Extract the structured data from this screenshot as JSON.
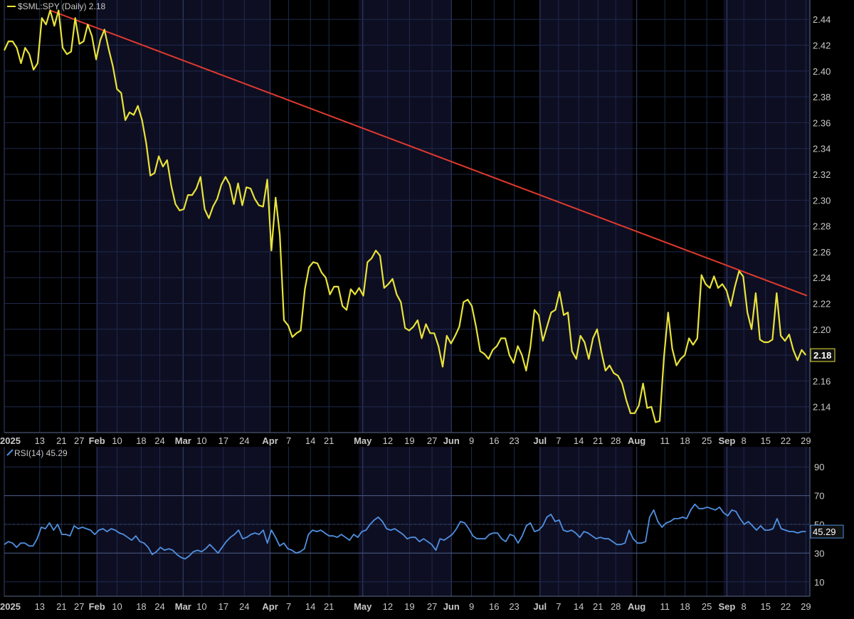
{
  "chart_data": [
    {
      "type": "line",
      "title": "$SML:SPY (Daily) 2.18",
      "last_value_label": "2.18",
      "ylim": [
        2.12,
        2.455
      ],
      "yticks": [
        "2.44",
        "2.42",
        "2.40",
        "2.38",
        "2.36",
        "2.34",
        "2.32",
        "2.30",
        "2.28",
        "2.26",
        "2.24",
        "2.22",
        "2.20",
        "2.18",
        "2.16",
        "2.14"
      ],
      "grid": true,
      "x_tick_labels": [
        "2025",
        "13",
        "21",
        "27",
        "Feb",
        "10",
        "18",
        "24",
        "Mar",
        "10",
        "17",
        "24",
        "Apr",
        "7",
        "14",
        "21",
        "May",
        "12",
        "19",
        "27",
        "Jun",
        "9",
        "16",
        "23",
        "Jul",
        "7",
        "14",
        "21",
        "28",
        "Aug",
        "11",
        "18",
        "25",
        "Sep",
        "8",
        "15",
        "22",
        "29"
      ],
      "series": [
        {
          "name": "$SML:SPY",
          "color": "#e8e33a",
          "values": [
            2.416,
            2.423,
            2.423,
            2.418,
            2.406,
            2.418,
            2.413,
            2.401,
            2.406,
            2.441,
            2.436,
            2.447,
            2.435,
            2.447,
            2.418,
            2.413,
            2.415,
            2.441,
            2.421,
            2.423,
            2.436,
            2.427,
            2.409,
            2.424,
            2.432,
            2.417,
            2.404,
            2.386,
            2.383,
            2.362,
            2.368,
            2.366,
            2.373,
            2.362,
            2.344,
            2.319,
            2.321,
            2.334,
            2.326,
            2.331,
            2.311,
            2.297,
            2.292,
            2.293,
            2.304,
            2.304,
            2.309,
            2.318,
            2.293,
            2.286,
            2.295,
            2.301,
            2.312,
            2.318,
            2.312,
            2.297,
            2.313,
            2.296,
            2.31,
            2.309,
            2.301,
            2.296,
            2.295,
            2.316,
            2.261,
            2.302,
            2.273,
            2.207,
            2.203,
            2.194,
            2.197,
            2.199,
            2.231,
            2.248,
            2.252,
            2.251,
            2.244,
            2.24,
            2.227,
            2.233,
            2.233,
            2.218,
            2.215,
            2.231,
            2.227,
            2.232,
            2.226,
            2.252,
            2.255,
            2.261,
            2.257,
            2.232,
            2.235,
            2.239,
            2.227,
            2.221,
            2.201,
            2.199,
            2.202,
            2.207,
            2.193,
            2.204,
            2.197,
            2.197,
            2.187,
            2.171,
            2.195,
            2.189,
            2.195,
            2.202,
            2.221,
            2.223,
            2.218,
            2.202,
            2.183,
            2.181,
            2.177,
            2.184,
            2.187,
            2.193,
            2.193,
            2.18,
            2.174,
            2.187,
            2.18,
            2.168,
            2.186,
            2.215,
            2.211,
            2.191,
            2.202,
            2.213,
            2.215,
            2.229,
            2.211,
            2.213,
            2.183,
            2.177,
            2.195,
            2.19,
            2.177,
            2.193,
            2.2,
            2.183,
            2.168,
            2.172,
            2.166,
            2.164,
            2.158,
            2.145,
            2.135,
            2.135,
            2.141,
            2.158,
            2.139,
            2.14,
            2.128,
            2.129,
            2.178,
            2.213,
            2.185,
            2.172,
            2.177,
            2.18,
            2.193,
            2.188,
            2.193,
            2.242,
            2.235,
            2.232,
            2.241,
            2.232,
            2.235,
            2.23,
            2.218,
            2.233,
            2.245,
            2.241,
            2.213,
            2.2,
            2.228,
            2.192,
            2.19,
            2.19,
            2.192,
            2.228,
            2.195,
            2.191,
            2.196,
            2.184,
            2.176,
            2.184,
            2.18
          ]
        }
      ],
      "trendline": {
        "color": "#e03a2e",
        "start_value": 2.447,
        "end_value": 2.226
      }
    },
    {
      "type": "line",
      "title": "RSI(14) 45.29",
      "last_value_label": "45.29",
      "ylim": [
        0,
        100
      ],
      "yticks": [
        "90",
        "70",
        "50",
        "30",
        "10"
      ],
      "overbought": 70,
      "oversold": 30,
      "grid": true,
      "x_tick_labels": [
        "2025",
        "13",
        "21",
        "27",
        "Feb",
        "10",
        "18",
        "24",
        "Mar",
        "10",
        "17",
        "24",
        "Apr",
        "7",
        "14",
        "21",
        "May",
        "12",
        "19",
        "27",
        "Jun",
        "9",
        "16",
        "23",
        "Jul",
        "7",
        "14",
        "21",
        "28",
        "Aug",
        "11",
        "18",
        "25",
        "Sep",
        "8",
        "15",
        "22",
        "29"
      ],
      "series": [
        {
          "name": "RSI(14)",
          "color": "#4f90e0",
          "values": [
            36,
            38,
            37,
            34,
            37,
            37,
            35,
            35,
            40,
            48,
            47,
            51,
            46,
            50,
            43,
            43,
            42,
            49,
            47,
            48,
            47,
            46,
            43,
            46,
            47,
            45,
            47,
            46,
            44,
            43,
            41,
            39,
            42,
            38,
            37,
            34,
            29,
            31,
            34,
            32,
            33,
            32,
            29,
            27,
            26,
            28,
            31,
            32,
            31,
            33,
            36,
            33,
            30,
            34,
            38,
            41,
            43,
            46,
            40,
            41,
            43,
            44,
            43,
            46,
            37,
            46,
            41,
            35,
            37,
            33,
            32,
            30,
            31,
            33,
            43,
            46,
            45,
            46,
            44,
            42,
            42,
            41,
            43,
            41,
            39,
            43,
            41,
            45,
            46,
            50,
            53,
            55,
            52,
            47,
            46,
            47,
            45,
            43,
            40,
            41,
            41,
            38,
            40,
            38,
            36,
            32,
            40,
            39,
            41,
            43,
            47,
            52,
            51,
            47,
            42,
            40,
            40,
            40,
            43,
            44,
            44,
            40,
            38,
            43,
            42,
            37,
            42,
            49,
            51,
            45,
            46,
            49,
            55,
            57,
            52,
            53,
            46,
            45,
            46,
            44,
            41,
            45,
            44,
            42,
            40,
            41,
            40,
            40,
            38,
            36,
            36,
            37,
            46,
            40,
            37,
            37,
            38,
            55,
            60,
            52,
            48,
            51,
            52,
            54,
            54,
            55,
            54,
            60,
            64,
            61,
            61,
            62,
            61,
            60,
            62,
            58,
            56,
            60,
            59,
            54,
            50,
            52,
            49,
            46,
            49,
            46,
            46,
            47,
            54,
            47,
            46,
            45,
            45,
            44,
            45,
            45
          ]
        }
      ]
    }
  ]
}
